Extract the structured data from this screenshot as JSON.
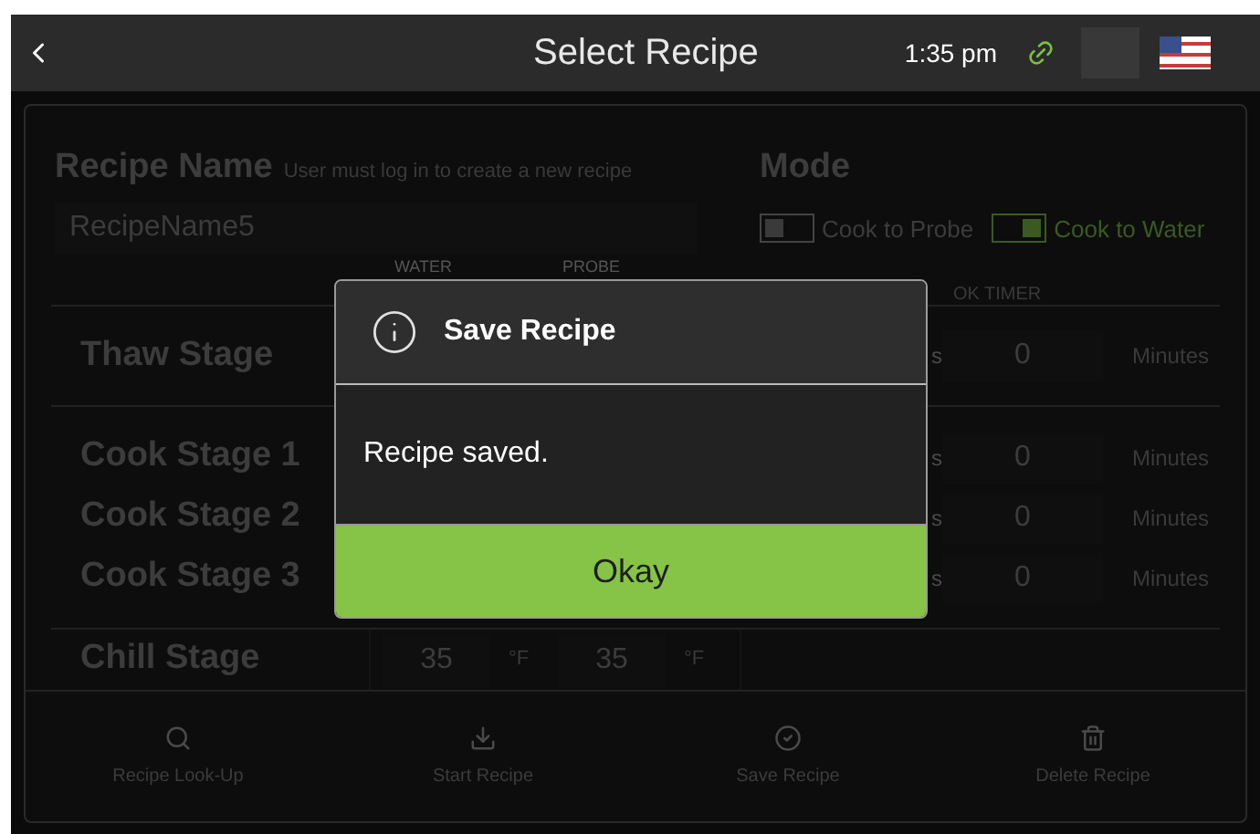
{
  "header": {
    "title": "Select Recipe",
    "time": "1:35 pm"
  },
  "recipe": {
    "label": "Recipe Name",
    "hint": "User must log in to create a new recipe",
    "value": "RecipeName5"
  },
  "mode": {
    "label": "Mode",
    "options": [
      {
        "label": "Cook to Probe",
        "selected": false
      },
      {
        "label": "Cook to Water",
        "selected": true
      }
    ]
  },
  "columns": [
    "WATER",
    "PROBE",
    "OK TIMER"
  ],
  "stages": [
    {
      "name": "Thaw Stage",
      "kind": "timer",
      "unit": "s",
      "timer": "0",
      "timer_unit": "Minutes"
    },
    {
      "name": "Cook Stage 1",
      "kind": "timer",
      "unit": "s",
      "timer": "0",
      "timer_unit": "Minutes"
    },
    {
      "name": "Cook Stage 2",
      "kind": "timer",
      "unit": "s",
      "timer": "0",
      "timer_unit": "Minutes"
    },
    {
      "name": "Cook Stage 3",
      "kind": "timer",
      "unit": "s",
      "timer": "0",
      "timer_unit": "Minutes"
    },
    {
      "name": "Chill Stage",
      "kind": "temps",
      "temps": [
        {
          "value": "35",
          "unit": "°F"
        },
        {
          "value": "35",
          "unit": "°F"
        }
      ]
    }
  ],
  "toolbar": [
    {
      "label": "Recipe Look-Up"
    },
    {
      "label": "Start Recipe"
    },
    {
      "label": "Save Recipe"
    },
    {
      "label": "Delete Recipe"
    }
  ],
  "dialog": {
    "title": "Save Recipe",
    "message": "Recipe saved.",
    "button": "Okay"
  }
}
